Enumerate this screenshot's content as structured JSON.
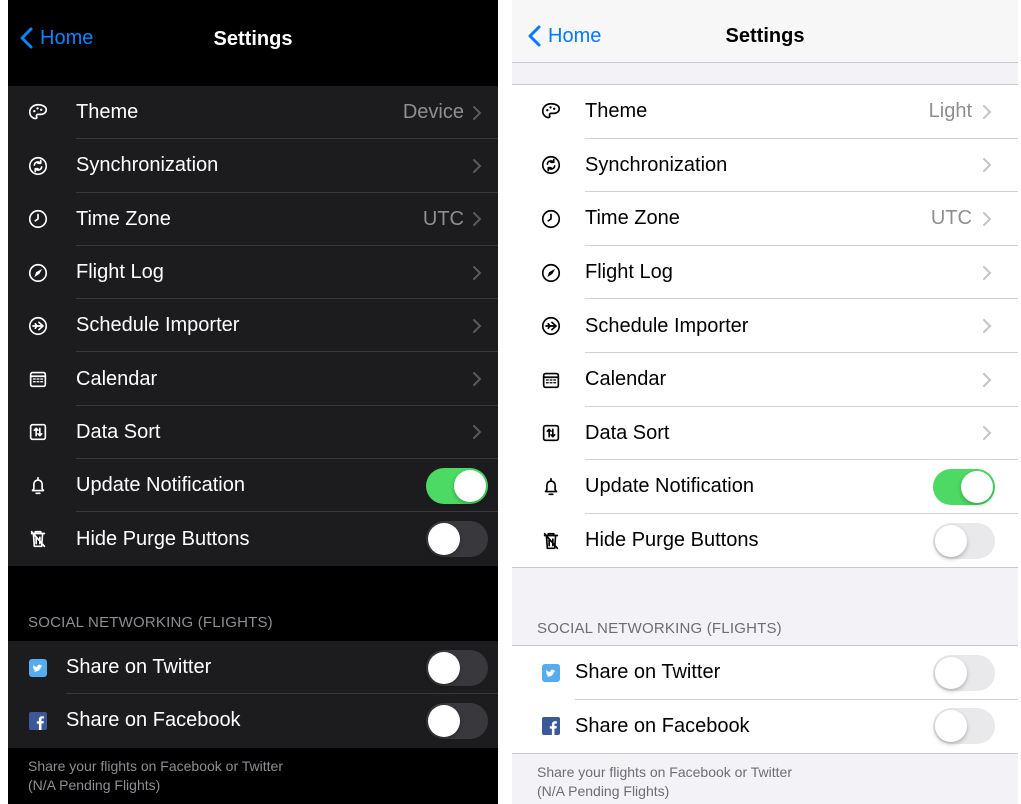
{
  "nav": {
    "back_label": "Home",
    "title": "Settings"
  },
  "dark": {
    "theme_value": "Device",
    "timezone_value": "UTC"
  },
  "light": {
    "theme_value": "Light",
    "timezone_value": "UTC"
  },
  "rows": {
    "theme": "Theme",
    "sync": "Synchronization",
    "timezone": "Time Zone",
    "flightlog": "Flight Log",
    "scheduler": "Schedule Importer",
    "calendar": "Calendar",
    "datasort": "Data Sort",
    "update_notification": "Update Notification",
    "hide_purge": "Hide Purge Buttons"
  },
  "toggles": {
    "update_notification": true,
    "hide_purge": false,
    "share_twitter": false,
    "share_facebook": false
  },
  "social": {
    "header": "SOCIAL NETWORKING (FLIGHTS)",
    "twitter": "Share on Twitter",
    "facebook": "Share on Facebook",
    "footer_line1": "Share your flights on Facebook or Twitter",
    "footer_line2": "(N/A Pending Flights)"
  },
  "icons": [
    "chevron-left-icon",
    "palette-icon",
    "sync-icon",
    "clock-icon",
    "compass-icon",
    "plane-circle-icon",
    "calendar-icon",
    "sort-icon",
    "bell-icon",
    "trash-icon",
    "twitter-icon",
    "facebook-icon",
    "chevron-right-icon"
  ],
  "colors": {
    "accent_dark": "#0a84ff",
    "accent_light": "#007aff",
    "toggle_on": "#4cd964"
  }
}
